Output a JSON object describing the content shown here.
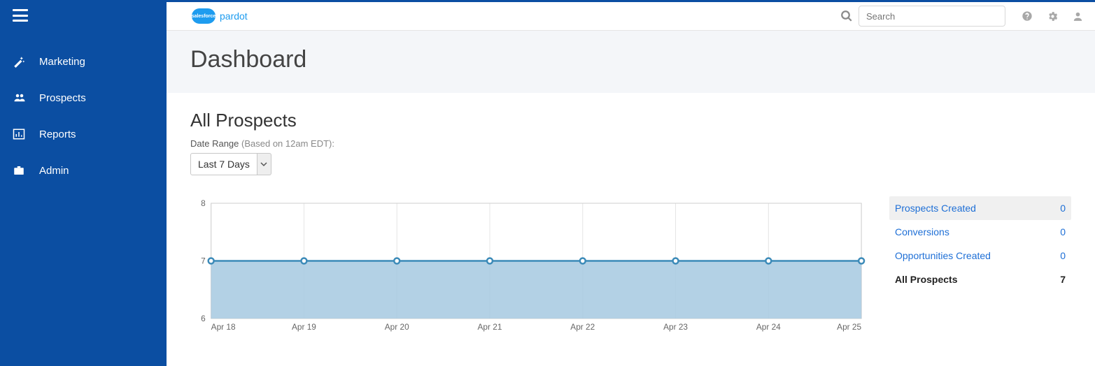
{
  "brand": {
    "cloud_text": "salesforce",
    "word": "pardot"
  },
  "search": {
    "placeholder": "Search"
  },
  "nav": [
    {
      "label": "Marketing",
      "icon": "wand"
    },
    {
      "label": "Prospects",
      "icon": "people"
    },
    {
      "label": "Reports",
      "icon": "bar"
    },
    {
      "label": "Admin",
      "icon": "briefcase"
    }
  ],
  "page": {
    "title": "Dashboard"
  },
  "section": {
    "title": "All Prospects"
  },
  "range": {
    "label": "Date Range",
    "sub": "(Based on 12am EDT):",
    "value": "Last 7 Days"
  },
  "legend": [
    {
      "name": "Prospects Created",
      "value": "0",
      "selected": true
    },
    {
      "name": "Conversions",
      "value": "0"
    },
    {
      "name": "Opportunities Created",
      "value": "0"
    },
    {
      "name": "All Prospects",
      "value": "7",
      "active": true
    }
  ],
  "chart_data": {
    "type": "area",
    "title": "",
    "xlabel": "",
    "ylabel": "",
    "ylim": [
      6,
      8
    ],
    "yticks": [
      6,
      7,
      8
    ],
    "categories": [
      "Apr 18",
      "Apr 19",
      "Apr 20",
      "Apr 21",
      "Apr 22",
      "Apr 23",
      "Apr 24",
      "Apr 25"
    ],
    "series": [
      {
        "name": "All Prospects",
        "values": [
          7,
          7,
          7,
          7,
          7,
          7,
          7,
          7
        ],
        "color": "#3b8ab8",
        "fill": "#a6c9e0"
      }
    ]
  }
}
